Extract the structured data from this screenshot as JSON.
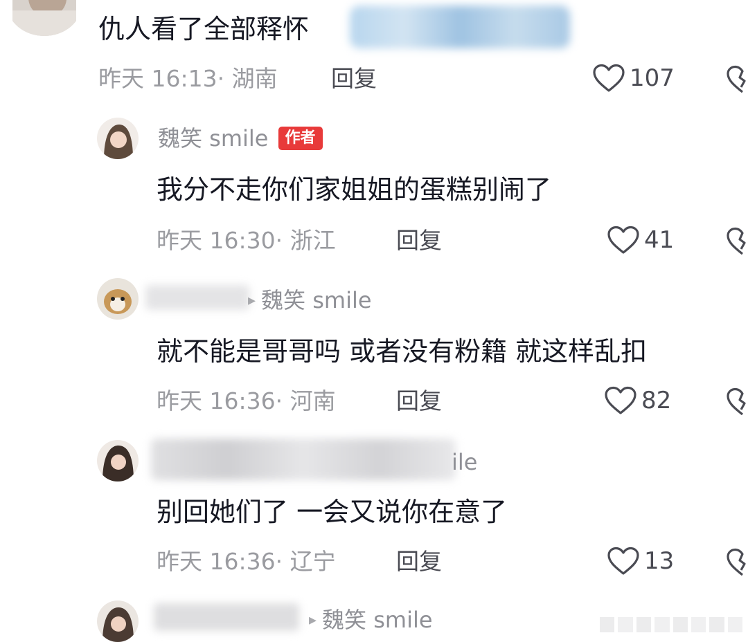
{
  "comments": [
    {
      "text": "仇人看了全部释怀",
      "time": "昨天 16:13",
      "location": "· 湖南",
      "reply_label": "回复",
      "likes": "107"
    },
    {
      "username": "魏笑 smile",
      "badge": "作者",
      "text": "我分不走你们家姐姐的蛋糕别闹了",
      "time": "昨天 16:30",
      "location": "· 浙江",
      "reply_label": "回复",
      "likes": "41"
    },
    {
      "reply_to": "魏笑 smile",
      "text": "就不能是哥哥吗 或者没有粉籍 就这样乱扣",
      "time": "昨天 16:36",
      "location": "· 河南",
      "reply_label": "回复",
      "likes": "82"
    },
    {
      "username_partial": "ile",
      "text": "别回她们了 一会又说你在意了",
      "time": "昨天 16:36",
      "location": "· 辽宁",
      "reply_label": "回复",
      "likes": "13"
    },
    {
      "reply_to": "魏笑 smile"
    }
  ],
  "icons": {
    "like": "heart-outline-icon",
    "dislike": "broken-heart-icon"
  },
  "colors": {
    "badge": "#e83a3a",
    "meta": "#9a9ba0",
    "text": "#161823"
  }
}
